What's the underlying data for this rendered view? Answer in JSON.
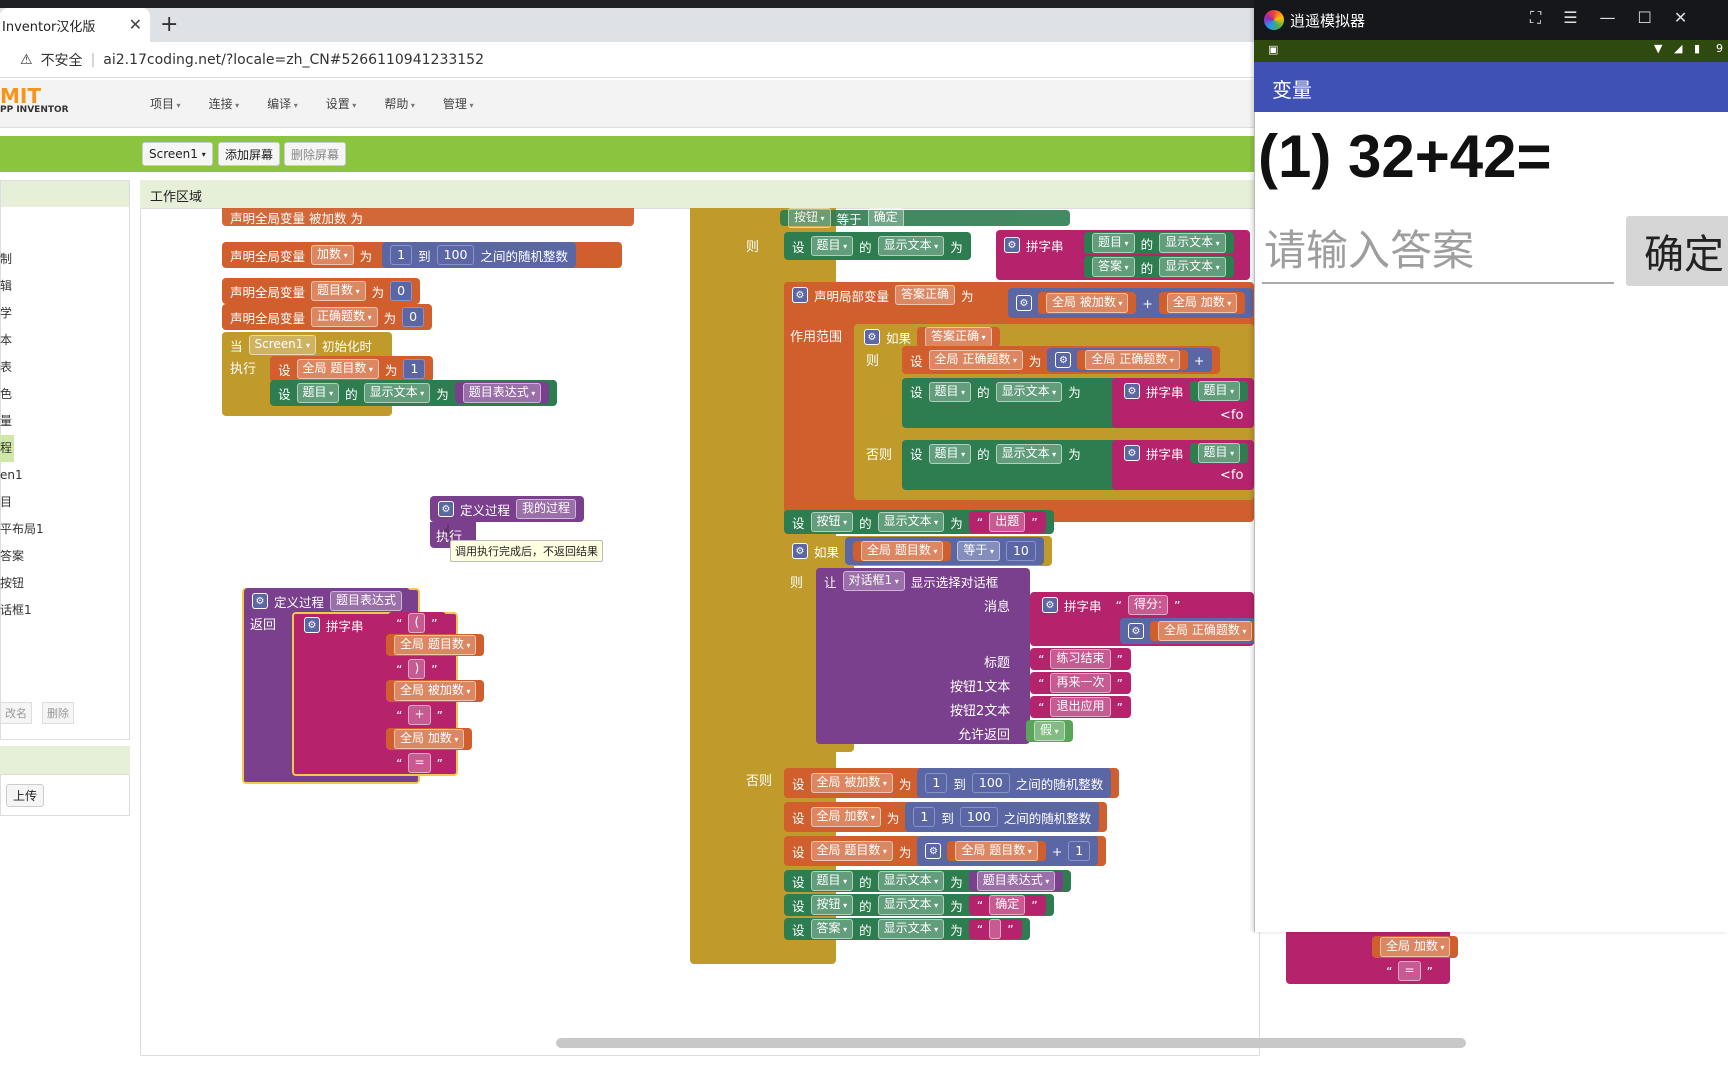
{
  "browser": {
    "tab_title": "Inventor汉化版",
    "new_tab": "+",
    "close": "✕",
    "security": "不安全",
    "url": "ai2.17coding.net/?locale=zh_CN#5266110941233152"
  },
  "app": {
    "logo_top": "MIT",
    "logo_bottom": "PP INVENTOR",
    "menu": [
      "项目",
      "连接",
      "编译",
      "设置",
      "帮助",
      "管理"
    ],
    "screen_select": "Screen1",
    "add_screen": "添加屏幕",
    "remove_screen": "删除屏幕",
    "workspace_title": "工作区域",
    "left_tree": [
      "制",
      "辑",
      "学",
      "本",
      "表",
      "色",
      "量",
      "程",
      "en1",
      "目",
      "平布局1",
      "答案",
      "按钮",
      "话框1"
    ],
    "rename": "改名",
    "delete": "删除",
    "upload": "上传"
  },
  "blocks": {
    "left": {
      "decl_partial": "声明全局变量 被加数 为",
      "decl_add": "声明全局变量",
      "var_add": "加数",
      "decl_count": "声明全局变量",
      "var_count": "题目数",
      "decl_correct": "声明全局变量",
      "var_correct": "正确题数",
      "as": "为",
      "n1": "1",
      "to": "到",
      "n100": "100",
      "random": "之间的随机整数",
      "zero": "0",
      "when": "当",
      "screen1": "Screen1",
      "init": "初始化时",
      "do": "执行",
      "set": "设",
      "global_count": "全局 题目数",
      "one": "1",
      "question": "题目",
      "of": "的",
      "text": "显示文本",
      "expr": "题目表达式",
      "def_proc": "定义过程",
      "my_proc": "我的过程",
      "exec": "执行",
      "tooltip": "调用执行完成后，不返回结果",
      "def_proc2": "定义过程",
      "proc_expr": "题目表达式",
      "return": "返回",
      "join": "拼字串",
      "paren_open": "(",
      "g_count": "全局 题目数",
      "paren_close": ")",
      "g_addend": "全局 被加数",
      "plus": "+",
      "g_add": "全局 加数",
      "eq": "="
    },
    "right": {
      "then": "则",
      "button": "按钮",
      "equals": "等于",
      "ok": "确定",
      "set": "设",
      "question": "题目",
      "of": "的",
      "text": "显示文本",
      "as": "为",
      "join": "拼字串",
      "answer": "答案",
      "local_decl": "声明局部变量",
      "correct_var": "答案正确",
      "g_addend": "全局 被加数",
      "plus": "+",
      "g_add": "全局 加数",
      "scope": "作用范围",
      "if": "如果",
      "g_correct": "全局 正确题数",
      "else": "否则",
      "fo": "<fo",
      "out_q": "出题",
      "g_count": "全局 题目数",
      "ten": "10",
      "let": "让",
      "dialog": "对话框1",
      "show_dialog": "显示选择对话框",
      "message": "消息",
      "score": "得分:",
      "title": "标题",
      "done": "练习结束",
      "b1": "按钮1文本",
      "again": "再来一次",
      "b2": "按钮2文本",
      "quit": "退出应用",
      "cancelable": "允许返回",
      "false": "假",
      "n1": "1",
      "to": "到",
      "n100": "100",
      "random": "之间的随机整数",
      "expr": "题目表达式",
      "empty": " "
    }
  },
  "emulator": {
    "title": "逍遥模拟器",
    "appbar": "变量",
    "question": "(1) 32+42=",
    "placeholder": "请输入答案",
    "confirm": "确定",
    "battery": "9"
  }
}
